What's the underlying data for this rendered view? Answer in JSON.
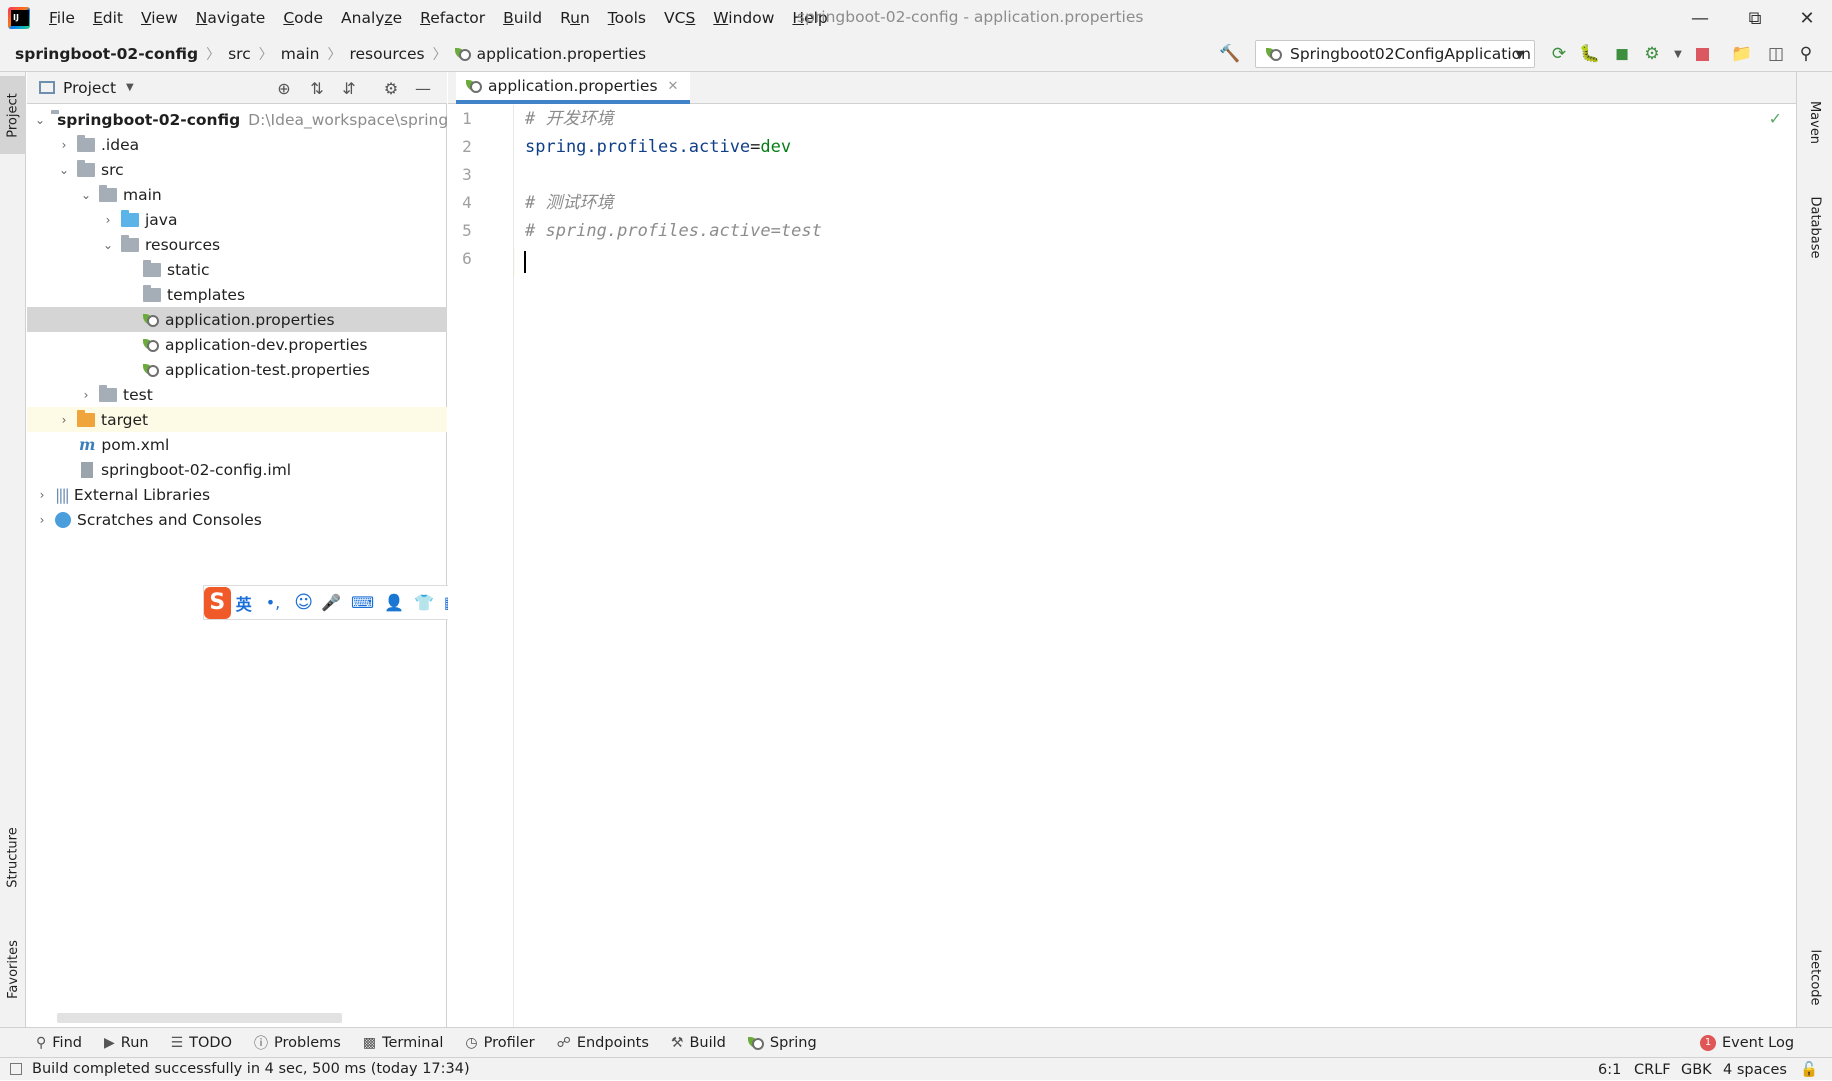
{
  "menubar": {
    "items": [
      {
        "label": "File",
        "ul": "F"
      },
      {
        "label": "Edit",
        "ul": "E"
      },
      {
        "label": "View",
        "ul": "V"
      },
      {
        "label": "Navigate",
        "ul": "N"
      },
      {
        "label": "Code",
        "ul": "C"
      },
      {
        "label": "Analyze",
        "ul": "z"
      },
      {
        "label": "Refactor",
        "ul": "R"
      },
      {
        "label": "Build",
        "ul": "B"
      },
      {
        "label": "Run",
        "ul": "u"
      },
      {
        "label": "Tools",
        "ul": "T"
      },
      {
        "label": "VCS",
        "ul": "S"
      },
      {
        "label": "Window",
        "ul": "W"
      },
      {
        "label": "Help",
        "ul": "H"
      }
    ],
    "window_title": "springboot-02-config - application.properties"
  },
  "breadcrumb": {
    "project": "springboot-02-config",
    "src": "src",
    "main": "main",
    "resources": "resources",
    "file": "application.properties"
  },
  "toolbar": {
    "run_config": "Springboot02ConfigApplication"
  },
  "side_tabs": {
    "project": "Project",
    "structure": "Structure",
    "favorites": "Favorites",
    "maven": "Maven",
    "database": "Database",
    "leetcode": "leetcode"
  },
  "project_panel": {
    "title": "Project",
    "root_name": "springboot-02-config",
    "root_path": "D:\\Idea_workspace\\springboot-",
    "items": {
      "idea": ".idea",
      "src": "src",
      "main": "main",
      "java": "java",
      "resources": "resources",
      "static": "static",
      "templates": "templates",
      "app_props": "application.properties",
      "app_dev_props": "application-dev.properties",
      "app_test_props": "application-test.properties",
      "test": "test",
      "target": "target",
      "pom": "pom.xml",
      "iml": "springboot-02-config.iml",
      "ext_libs": "External Libraries",
      "scratches": "Scratches and Consoles"
    }
  },
  "ime": {
    "mode": "英"
  },
  "editor": {
    "tab_label": "application.properties",
    "lines": [
      {
        "num": "1",
        "comment": "# 开发环境"
      },
      {
        "num": "2",
        "key": "spring.profiles.active",
        "eq": "=",
        "value": "dev"
      },
      {
        "num": "3"
      },
      {
        "num": "4",
        "comment": "# 测试环境"
      },
      {
        "num": "5",
        "comment": "# spring.profiles.active=test"
      },
      {
        "num": "6"
      }
    ]
  },
  "bottom_tabs": {
    "find": "Find",
    "run": "Run",
    "todo": "TODO",
    "problems": "Problems",
    "terminal": "Terminal",
    "profiler": "Profiler",
    "endpoints": "Endpoints",
    "build": "Build",
    "spring": "Spring",
    "event_log": "Event Log",
    "event_log_count": "1"
  },
  "status_bar": {
    "message": "Build completed successfully in 4 sec, 500 ms (today 17:34)",
    "position": "6:1",
    "line_sep": "CRLF",
    "encoding": "GBK",
    "indent": "4 spaces"
  },
  "colors": {
    "accent": "#4083c9",
    "spring_green": "#6aab3b",
    "key": "#0f3f87",
    "value": "#067d17",
    "comment": "#8c8c8c"
  }
}
